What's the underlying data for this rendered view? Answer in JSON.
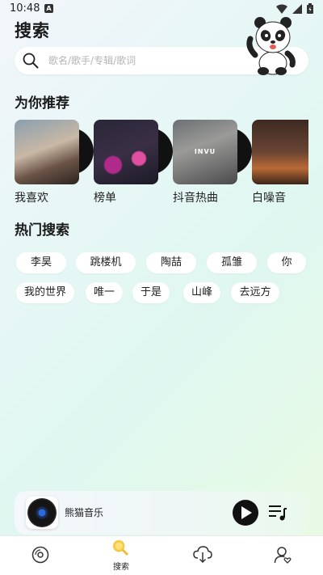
{
  "status_bar": {
    "time": "10:48",
    "notif_glyph": "A"
  },
  "page": {
    "title": "搜索"
  },
  "search": {
    "placeholder": "歌名/歌手/专辑/歌词",
    "value": ""
  },
  "recommend": {
    "title": "为你推荐",
    "items": [
      {
        "label": "我喜欢",
        "cover_text": ""
      },
      {
        "label": "榜单",
        "cover_text": ""
      },
      {
        "label": "抖音热曲",
        "cover_text": "INVU"
      },
      {
        "label": "白噪音",
        "cover_text": ""
      }
    ]
  },
  "hot_search": {
    "title": "热门搜索",
    "tags": [
      "李昊",
      "跳楼机",
      "陶喆",
      "孤雏",
      "你",
      "我的世界",
      "唯一",
      "于是",
      "山峰",
      "去远方"
    ]
  },
  "player": {
    "title": "熊猫音乐",
    "play_icon": "play-icon",
    "playlist_icon": "playlist-icon"
  },
  "tabbar": {
    "tabs": [
      {
        "label": "",
        "icon": "disc-icon"
      },
      {
        "label": "搜索",
        "icon": "search-tab-icon",
        "active": true
      },
      {
        "label": "",
        "icon": "download-cloud-icon"
      },
      {
        "label": "",
        "icon": "user-heart-icon"
      }
    ]
  },
  "colors": {
    "accent": "#f7c948",
    "tag_bg": "#ffffff",
    "tabbar_bg": "#ffffff"
  }
}
